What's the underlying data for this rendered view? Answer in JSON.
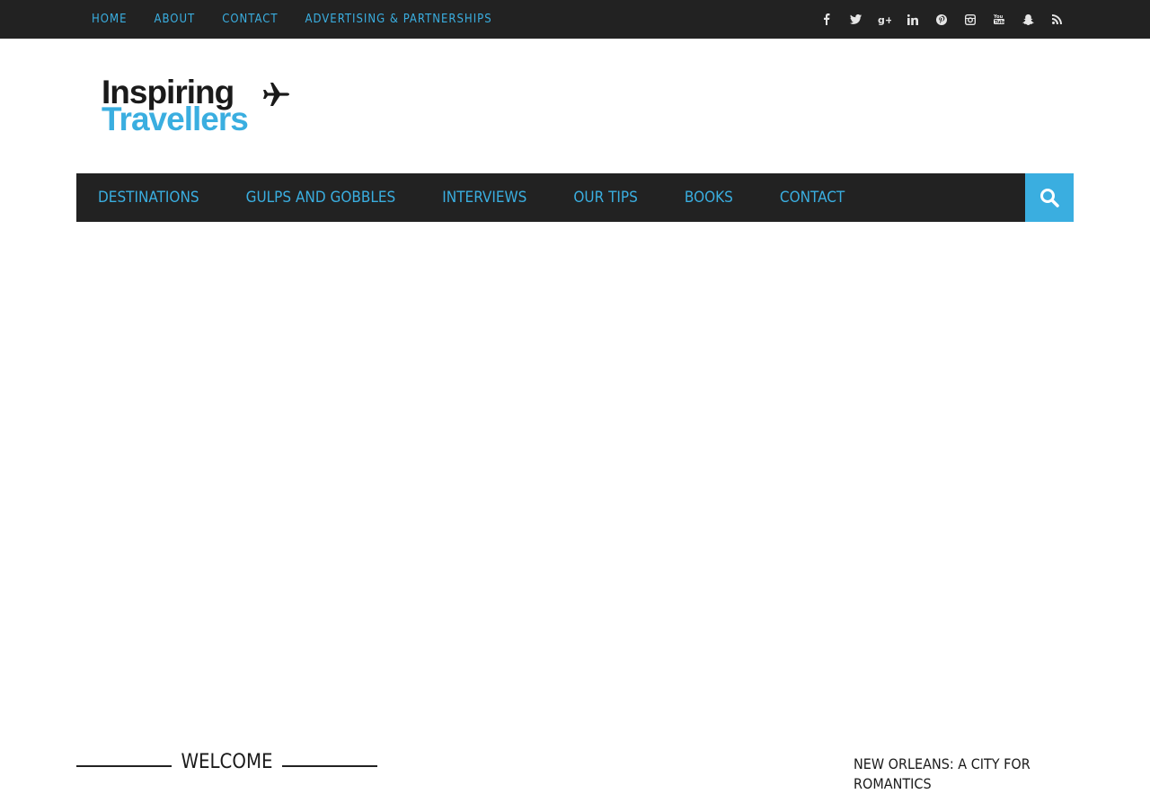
{
  "topnav": {
    "items": [
      "HOME",
      "ABOUT",
      "CONTACT",
      "ADVERTISING & PARTNERSHIPS"
    ]
  },
  "social": {
    "icons": [
      "facebook-icon",
      "twitter-icon",
      "google-plus-icon",
      "linkedin-icon",
      "pinterest-icon",
      "instagram-icon",
      "youtube-icon",
      "snapchat-icon",
      "rss-icon"
    ],
    "glyphs": [
      "f",
      "t",
      "g+",
      "in",
      "p",
      "◎",
      "▶",
      "👻",
      "))"
    ]
  },
  "logo": {
    "line1": "Inspiring",
    "line2": "Travellers"
  },
  "mainnav": {
    "items": [
      "DESTINATIONS",
      "GULPS AND GOBBLES",
      "INTERVIEWS",
      "OUR TIPS",
      "BOOKS",
      "CONTACT"
    ]
  },
  "welcome": {
    "title": "WELCOME"
  },
  "sidebar": {
    "post_title": "NEW ORLEANS: A CITY FOR ROMANTICS"
  },
  "colors": {
    "accent": "#3aaee0",
    "dark": "#222222"
  }
}
